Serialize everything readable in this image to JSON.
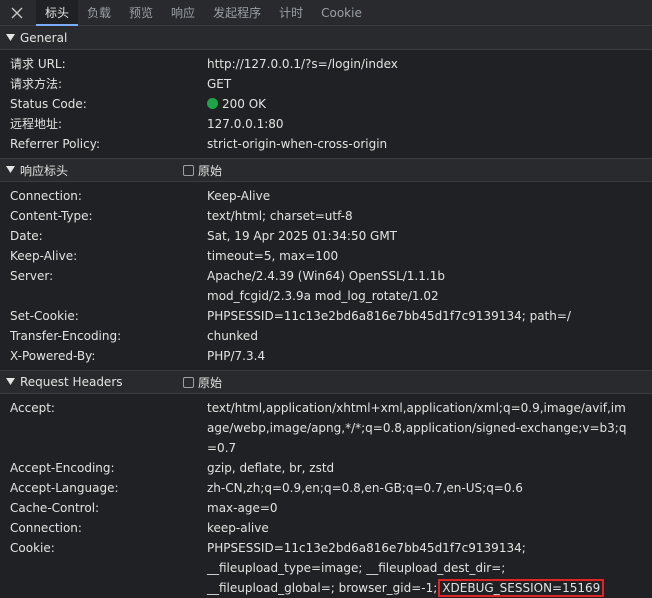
{
  "tabs": [
    "标头",
    "负载",
    "预览",
    "响应",
    "发起程序",
    "计时",
    "Cookie"
  ],
  "active_tab": 0,
  "general": {
    "title": "General",
    "rows": [
      {
        "k": "请求 URL:",
        "v": "http://127.0.0.1/?s=/login/index"
      },
      {
        "k": "请求方法:",
        "v": "GET"
      },
      {
        "k": "Status Code:",
        "v": "200 OK"
      },
      {
        "k": "远程地址:",
        "v": "127.0.0.1:80"
      },
      {
        "k": "Referrer Policy:",
        "v": "strict-origin-when-cross-origin"
      }
    ]
  },
  "response_headers": {
    "title": "响应标头",
    "raw_label": "原始",
    "rows": [
      {
        "k": "Connection:",
        "v": "Keep-Alive"
      },
      {
        "k": "Content-Type:",
        "v": "text/html; charset=utf-8"
      },
      {
        "k": "Date:",
        "v": "Sat, 19 Apr 2025 01:34:50 GMT"
      },
      {
        "k": "Keep-Alive:",
        "v": "timeout=5, max=100"
      },
      {
        "k": "Server:",
        "v": "Apache/2.4.39 (Win64) OpenSSL/1.1.1b mod_fcgid/2.3.9a mod_log_rotate/1.02"
      },
      {
        "k": "Set-Cookie:",
        "v": "PHPSESSID=11c13e2bd6a816e7bb45d1f7c9139134; path=/"
      },
      {
        "k": "Transfer-Encoding:",
        "v": "chunked"
      },
      {
        "k": "X-Powered-By:",
        "v": "PHP/7.3.4"
      }
    ]
  },
  "request_headers": {
    "title": "Request Headers",
    "raw_label": "原始",
    "rows": [
      {
        "k": "Accept:",
        "v": "text/html,application/xhtml+xml,application/xml;q=0.9,image/avif,image/webp,image/apng,*/*;q=0.8,application/signed-exchange;v=b3;q=0.7"
      },
      {
        "k": "Accept-Encoding:",
        "v": "gzip, deflate, br, zstd"
      },
      {
        "k": "Accept-Language:",
        "v": "zh-CN,zh;q=0.9,en;q=0.8,en-GB;q=0.7,en-US;q=0.6"
      },
      {
        "k": "Cache-Control:",
        "v": "max-age=0"
      },
      {
        "k": "Connection:",
        "v": "keep-alive"
      }
    ],
    "cookie": {
      "k": "Cookie:",
      "v_before": "PHPSESSID=11c13e2bd6a816e7bb45d1f7c9139134; __fileupload_type=image; __fileupload_dest_dir=; __fileupload_global=; browser_gid=-1;",
      "v_highlight": "XDEBUG_SESSION=15169"
    }
  },
  "colors": {
    "status_ok": "#1ea446",
    "highlight_border": "#e02424",
    "active_tab_underline": "#7cacf8"
  }
}
